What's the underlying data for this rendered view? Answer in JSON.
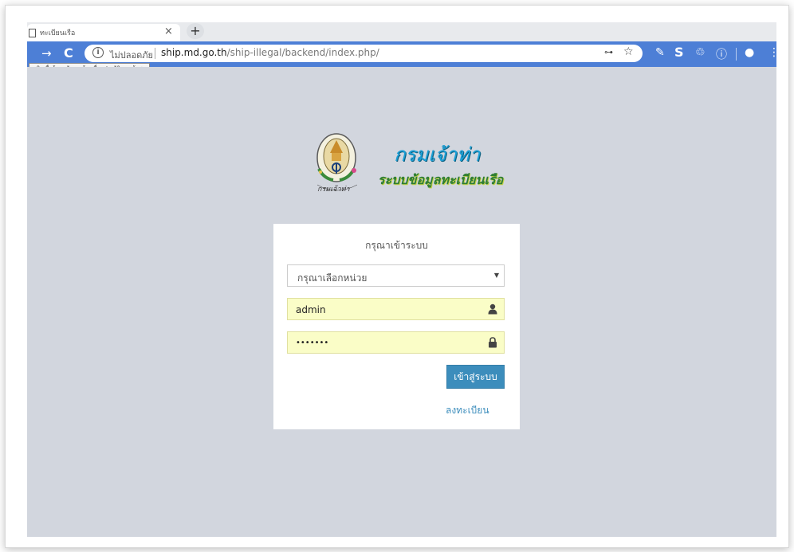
{
  "browser": {
    "tab_title": "ทะเบียนเรือ",
    "tab_close": "×",
    "new_tab": "+",
    "security_label": "ไม่ปลอดภัย",
    "url_host": "ship.md.go.th",
    "url_path": "/ship-illegal/backend/index.php/",
    "tooltip": "คลิกเพื่อย้อนกลับ กดค้างเพื่อดูประวัติการเข้าชม",
    "toolbar_color": "#4d7fd6"
  },
  "header": {
    "title": "กรมเจ้าท่า",
    "subtitle": "ระบบข้อมูลทะเบียนเรือ",
    "seal_text": "กรมเจ้าท่า"
  },
  "login": {
    "heading": "กรุณาเข้าระบบ",
    "unit_select_value": "กรุณาเลือกหน่วย",
    "username_value": "admin",
    "password_value": "•••••••",
    "submit_label": "เข้าสู่ระบบ",
    "register_label": "ลงทะเบียน"
  },
  "colors": {
    "page_bg": "#d2d6de",
    "accent": "#3c8dbc",
    "autofill": "#fafdc7"
  }
}
